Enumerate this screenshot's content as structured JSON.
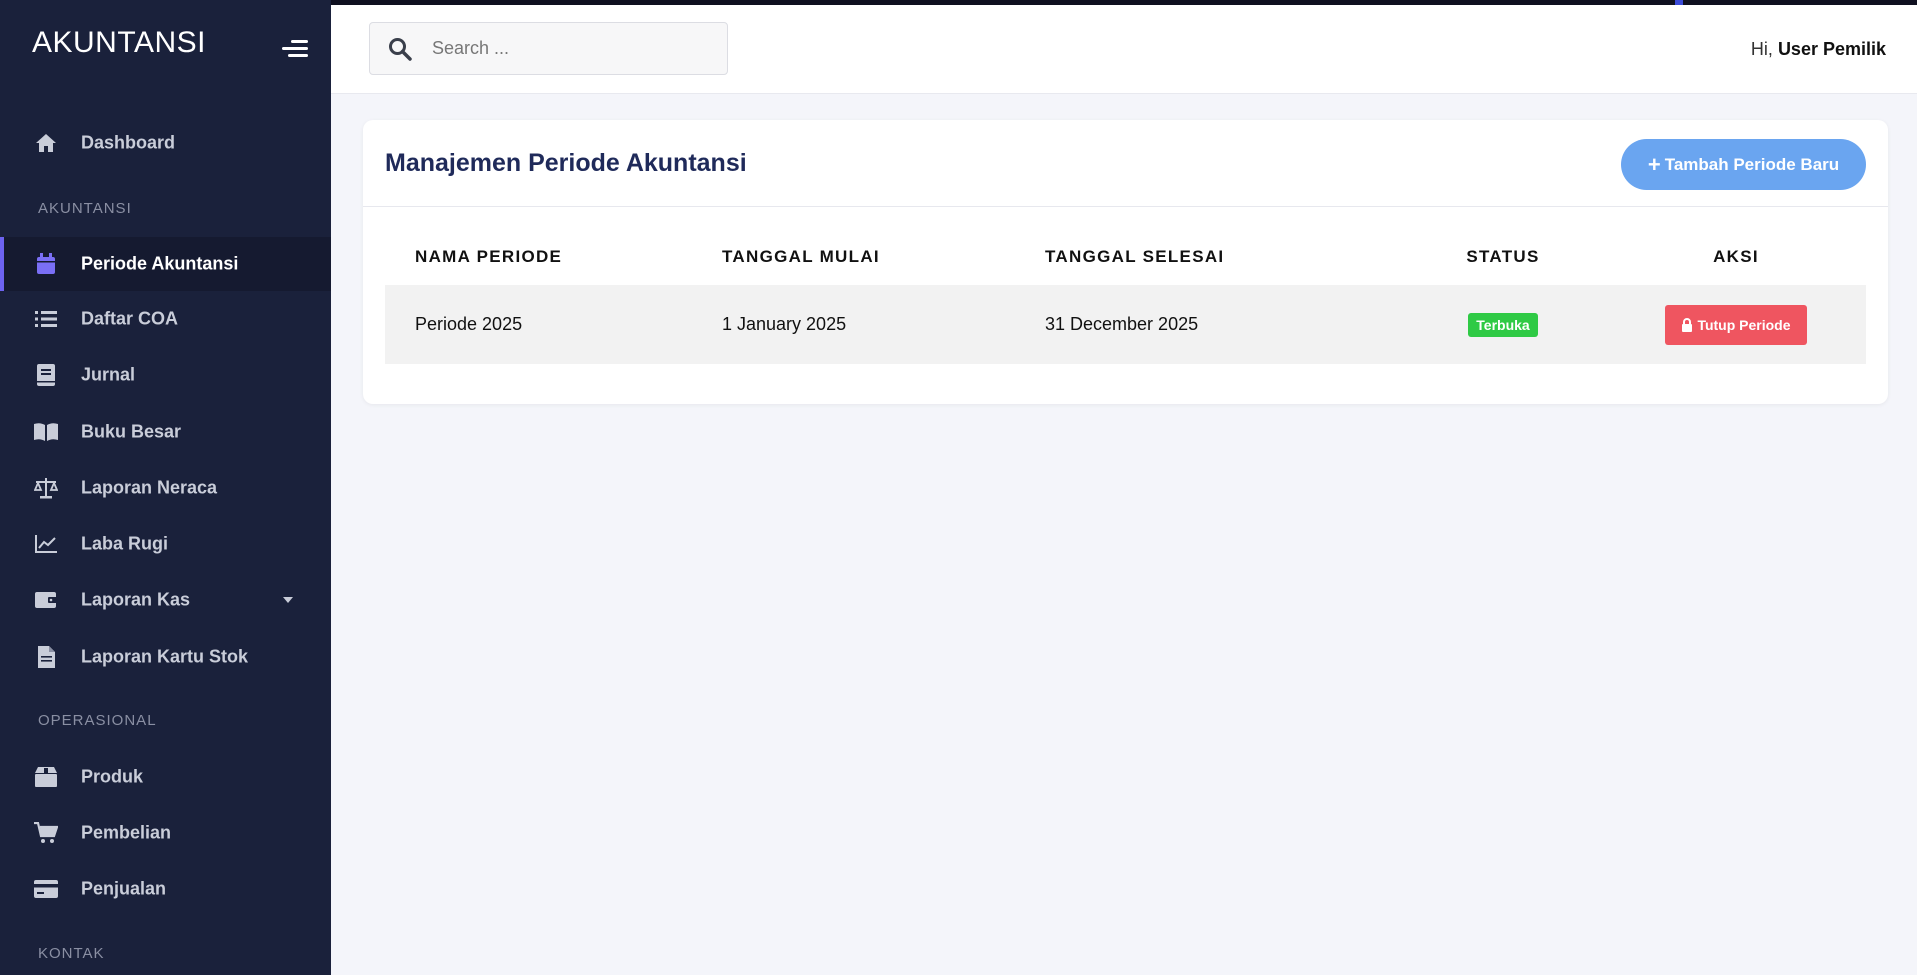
{
  "brand": "AKUNTANSI",
  "sidebar": {
    "items_top": [
      {
        "label": "Dashboard",
        "icon": "home-icon"
      }
    ],
    "section_akuntansi": "AKUNTANSI",
    "akuntansi_items": [
      {
        "label": "Periode Akuntansi",
        "icon": "calendar-icon",
        "active": true
      },
      {
        "label": "Daftar COA",
        "icon": "list-icon"
      },
      {
        "label": "Jurnal",
        "icon": "book-icon"
      },
      {
        "label": "Buku Besar",
        "icon": "open-book-icon"
      },
      {
        "label": "Laporan Neraca",
        "icon": "balance-scale-icon"
      },
      {
        "label": "Laba Rugi",
        "icon": "chart-line-icon"
      },
      {
        "label": "Laporan Kas",
        "icon": "wallet-icon",
        "has_dropdown": true
      },
      {
        "label": "Laporan Kartu Stok",
        "icon": "file-icon"
      }
    ],
    "section_operasional": "OPERASIONAL",
    "operasional_items": [
      {
        "label": "Produk",
        "icon": "box-icon"
      },
      {
        "label": "Pembelian",
        "icon": "cart-icon"
      },
      {
        "label": "Penjualan",
        "icon": "credit-card-icon"
      }
    ],
    "section_kontak": "KONTAK"
  },
  "topbar": {
    "search_placeholder": "Search ...",
    "greeting_prefix": "Hi,",
    "user_name": "User Pemilik"
  },
  "main": {
    "title": "Manajemen Periode Akuntansi",
    "add_button_label": "Tambah Periode Baru",
    "table": {
      "headers": [
        "NAMA PERIODE",
        "TANGGAL MULAI",
        "TANGGAL SELESAI",
        "STATUS",
        "AKSI"
      ],
      "rows": [
        {
          "nama": "Periode 2025",
          "mulai": "1 January 2025",
          "selesai": "31 December 2025",
          "status": "Terbuka",
          "aksi": "Tutup Periode"
        }
      ]
    }
  },
  "colors": {
    "sidebar_bg": "#1a213b",
    "active_accent": "#6d63f0",
    "primary_button": "#6aa5f0",
    "status_open": "#2fca45",
    "danger": "#ef5560"
  }
}
